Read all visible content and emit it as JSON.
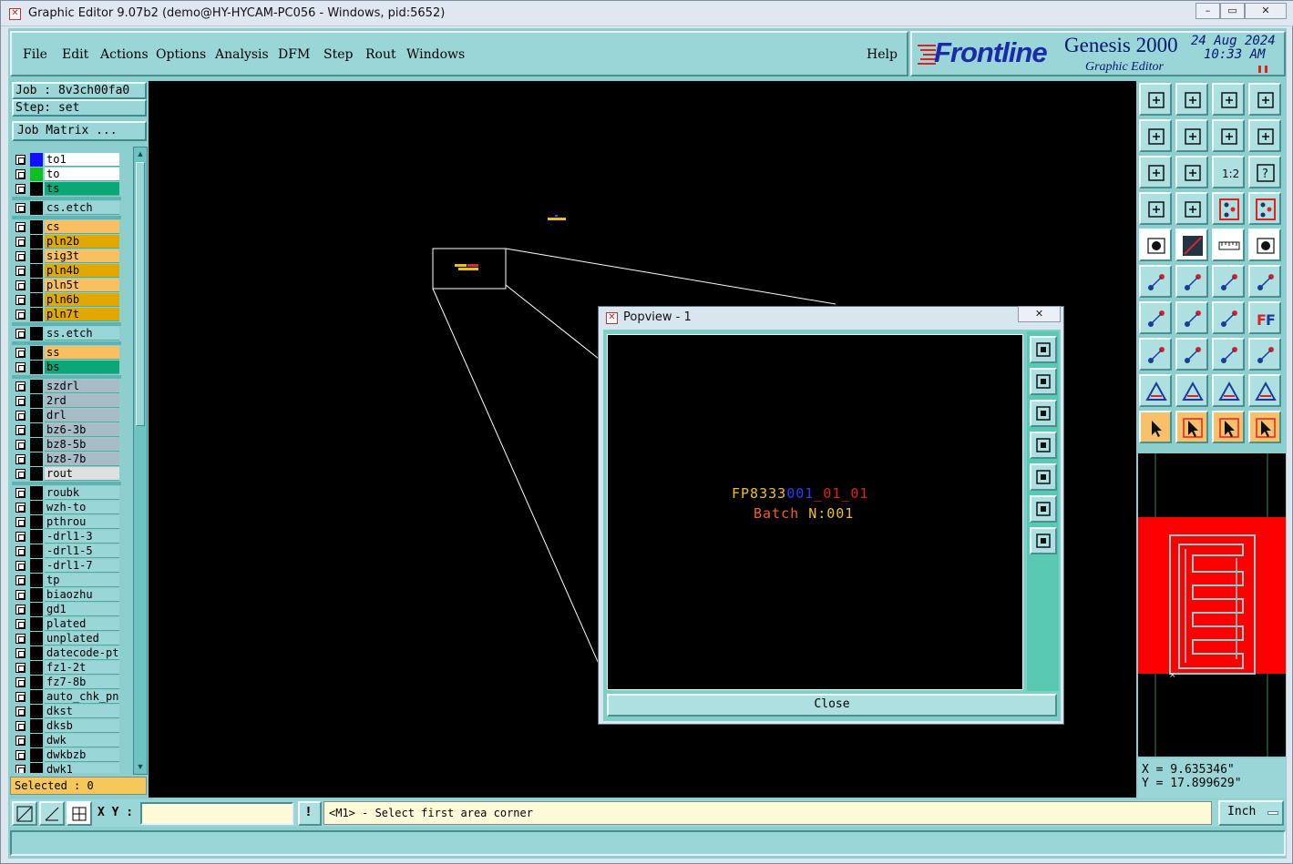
{
  "window": {
    "title": "Graphic Editor 9.07b2 (demo@HY-HYCAM-PC056 - Windows, pid:5652)"
  },
  "menu": {
    "items": [
      "File",
      "Edit",
      "Actions",
      "Options",
      "Analysis",
      "DFM",
      "Step",
      "Rout",
      "Windows"
    ],
    "help": "Help"
  },
  "brand": {
    "logo": "Frontline",
    "product": "Genesis 2000",
    "subtitle": "Graphic Editor",
    "date": "24 Aug 2024",
    "time": "10:33 AM"
  },
  "job": {
    "label": "Job : 8v3ch00fa0",
    "step": "Step: set",
    "matrix_button": "Job Matrix ..."
  },
  "layers": [
    {
      "name": "to1",
      "color": "#ffffff",
      "swatch": "#1010ff"
    },
    {
      "name": "to",
      "color": "#ffffff",
      "swatch": "#10c020"
    },
    {
      "name": "ts",
      "color": "#0aa877",
      "swatch": "#000000"
    },
    {
      "gap": true
    },
    {
      "name": "cs.etch",
      "color": "#9ad6d8",
      "swatch": "#000000"
    },
    {
      "gap": true
    },
    {
      "name": "cs",
      "color": "#f8c060",
      "swatch": "#000000"
    },
    {
      "name": "pln2b",
      "color": "#e0a800",
      "swatch": "#000000"
    },
    {
      "name": "sig3t",
      "color": "#f8c060",
      "swatch": "#000000"
    },
    {
      "name": "pln4b",
      "color": "#e0a800",
      "swatch": "#000000"
    },
    {
      "name": "pln5t",
      "color": "#f8c060",
      "swatch": "#000000"
    },
    {
      "name": "pln6b",
      "color": "#e0a800",
      "swatch": "#000000"
    },
    {
      "name": "pln7t",
      "color": "#e0a800",
      "swatch": "#000000"
    },
    {
      "gap": true
    },
    {
      "name": "ss.etch",
      "color": "#9ad6d8",
      "swatch": "#000000"
    },
    {
      "gap": true
    },
    {
      "name": "ss",
      "color": "#f8c060",
      "swatch": "#000000"
    },
    {
      "name": "bs",
      "color": "#0aa877",
      "swatch": "#000000"
    },
    {
      "gap": true
    },
    {
      "name": "szdrl",
      "color": "#a8bcc8",
      "swatch": "#000000"
    },
    {
      "name": "2rd",
      "color": "#a8bcc8",
      "swatch": "#000000"
    },
    {
      "name": "drl",
      "color": "#a8bcc8",
      "swatch": "#000000"
    },
    {
      "name": "bz6-3b",
      "color": "#a8bcc8",
      "swatch": "#000000"
    },
    {
      "name": "bz8-5b",
      "color": "#a8bcc8",
      "swatch": "#000000"
    },
    {
      "name": "bz8-7b",
      "color": "#a8bcc8",
      "swatch": "#000000"
    },
    {
      "name": "rout",
      "color": "#e0e0e0",
      "swatch": "#000000"
    },
    {
      "gap": true
    },
    {
      "name": "roubk",
      "color": "#9ad6d8",
      "swatch": "#000000"
    },
    {
      "name": "wzh-to",
      "color": "#9ad6d8",
      "swatch": "#000000"
    },
    {
      "name": "pthrou",
      "color": "#9ad6d8",
      "swatch": "#000000"
    },
    {
      "name": "-drl1-3",
      "color": "#9ad6d8",
      "swatch": "#000000"
    },
    {
      "name": "-drl1-5",
      "color": "#9ad6d8",
      "swatch": "#000000"
    },
    {
      "name": "-drl1-7",
      "color": "#9ad6d8",
      "swatch": "#000000"
    },
    {
      "name": "tp",
      "color": "#9ad6d8",
      "swatch": "#000000"
    },
    {
      "name": "biaozhu",
      "color": "#9ad6d8",
      "swatch": "#000000"
    },
    {
      "name": "gd1",
      "color": "#9ad6d8",
      "swatch": "#000000"
    },
    {
      "name": "plated",
      "color": "#9ad6d8",
      "swatch": "#000000"
    },
    {
      "name": "unplated",
      "color": "#9ad6d8",
      "swatch": "#000000"
    },
    {
      "name": "datecode-ptc",
      "color": "#9ad6d8",
      "swatch": "#000000"
    },
    {
      "name": "fz1-2t",
      "color": "#9ad6d8",
      "swatch": "#000000"
    },
    {
      "name": "fz7-8b",
      "color": "#9ad6d8",
      "swatch": "#000000"
    },
    {
      "name": "auto_chk_pni",
      "color": "#9ad6d8",
      "swatch": "#000000"
    },
    {
      "name": "dkst",
      "color": "#9ad6d8",
      "swatch": "#000000"
    },
    {
      "name": "dksb",
      "color": "#9ad6d8",
      "swatch": "#000000"
    },
    {
      "name": "dwk",
      "color": "#9ad6d8",
      "swatch": "#000000"
    },
    {
      "name": "dwkbzb",
      "color": "#9ad6d8",
      "swatch": "#000000"
    },
    {
      "name": "dwk1",
      "color": "#9ad6d8",
      "swatch": "#000000"
    }
  ],
  "selected": "Selected : 0",
  "coords": {
    "x": "X = 9.635346\"",
    "y": "Y = 17.899629\""
  },
  "command": {
    "xy_label": "X Y :",
    "xy_value": "",
    "prompt": "<M1> - Select first area corner",
    "units": "Inch"
  },
  "popview": {
    "title": "Popview - 1",
    "close_label": "Close",
    "text_line1_a": "FP8333",
    "text_line1_b": "001",
    "text_line1_c": "_01_01",
    "text_line2_a": "Batch ",
    "text_line2_b": "N:001"
  },
  "colors": {
    "accent": "#9ad6d8",
    "canvas": "#000000",
    "board": "#ff0000"
  }
}
